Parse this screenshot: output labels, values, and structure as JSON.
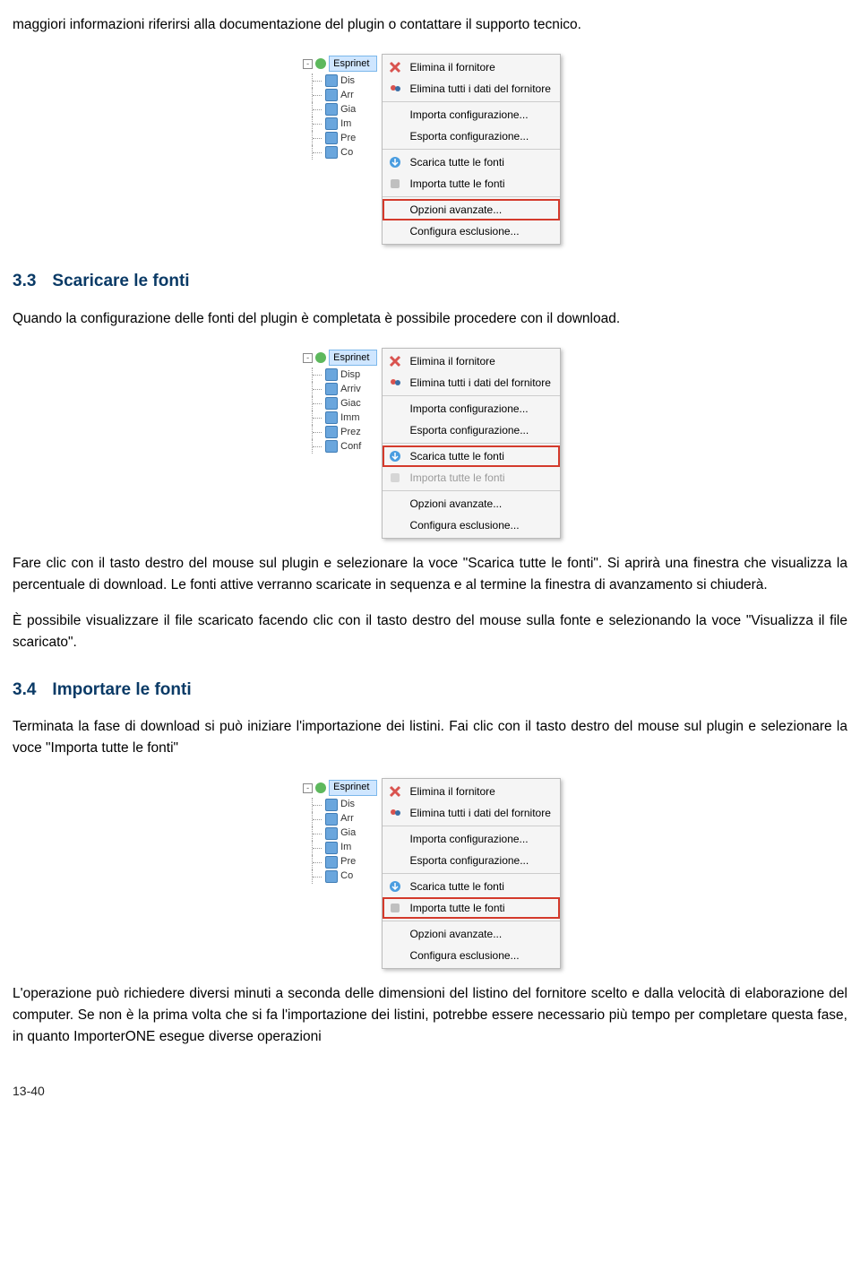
{
  "paragraphs": {
    "p_top": "maggiori informazioni riferirsi alla documentazione del plugin o contattare il supporto tecnico.",
    "s33_title_num": "3.3",
    "s33_title": "Scaricare le fonti",
    "s33_p1": "Quando la configurazione delle fonti del plugin è completata è possibile procedere con il download.",
    "s33_p2": " Fare clic con il tasto destro del mouse sul plugin e selezionare la voce \"Scarica tutte le fonti\". Si aprirà una finestra che visualizza la percentuale di download. Le fonti attive verranno scaricate in sequenza e al termine la finestra di avanzamento si chiuderà.",
    "s33_p3": " È possibile visualizzare il file scaricato facendo clic con il tasto destro del mouse sulla fonte e selezionando la voce \"Visualizza il file scaricato\".",
    "s34_title_num": "3.4",
    "s34_title": "Importare le fonti",
    "s34_p1": " Terminata la fase di download si può iniziare l'importazione dei listini. Fai clic con il tasto destro del mouse sul plugin e selezionare la voce \"Importa tutte le fonti\"",
    "s34_p2": " L'operazione può richiedere diversi minuti a seconda delle dimensioni del listino del fornitore scelto e dalla velocità di elaborazione del computer. Se non è la prima volta che si fa l'importazione dei listini, potrebbe essere necessario più tempo per completare questa fase, in quanto ImporterONE esegue diverse operazioni"
  },
  "tree": {
    "root": "Esprinet",
    "items_short": [
      "Dis",
      "Arr",
      "Gia",
      "Im",
      "Pre",
      "Co"
    ],
    "items_long": [
      "Disp",
      "Arriv",
      "Giac",
      "Imm",
      "Prez",
      "Conf"
    ]
  },
  "menu": {
    "elimina_fornitore": "Elimina il fornitore",
    "elimina_dati": "Elimina tutti i dati del fornitore",
    "importa_config": "Importa configurazione...",
    "esporta_config": "Esporta configurazione...",
    "scarica_tutte": "Scarica tutte le fonti",
    "importa_tutte": "Importa tutte le fonti",
    "opzioni": "Opzioni avanzate...",
    "configura": "Configura esclusione..."
  },
  "footer": "13-40"
}
